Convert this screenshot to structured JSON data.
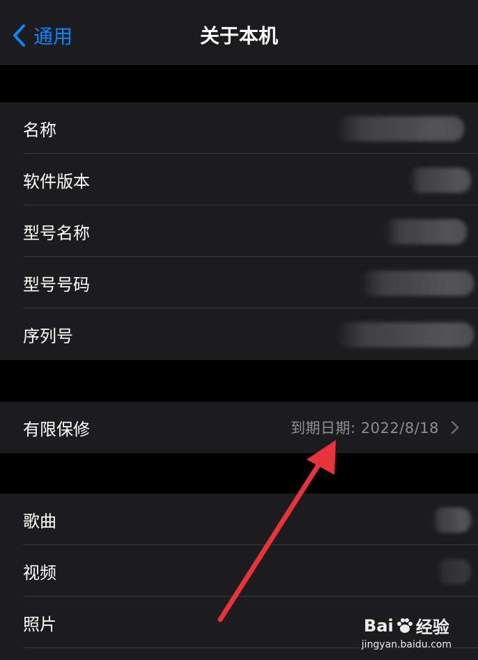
{
  "navbar": {
    "back_label": "通用",
    "title": "关于本机"
  },
  "group1": {
    "rows": [
      {
        "label": "名称"
      },
      {
        "label": "软件版本"
      },
      {
        "label": "型号名称"
      },
      {
        "label": "型号号码"
      },
      {
        "label": "序列号"
      }
    ]
  },
  "warranty": {
    "label": "有限保修",
    "value": "到期日期: 2022/8/18"
  },
  "media": {
    "rows": [
      {
        "label": "歌曲"
      },
      {
        "label": "视频"
      },
      {
        "label": "照片"
      }
    ]
  },
  "watermark": {
    "brand_left": "Bai",
    "brand_right": "经验",
    "url": "jingyan.baidu.com"
  },
  "colors": {
    "accent": "#0a84ff",
    "annotation_arrow": "#e8333a",
    "background": "#000000",
    "cell": "#1c1c1e"
  }
}
